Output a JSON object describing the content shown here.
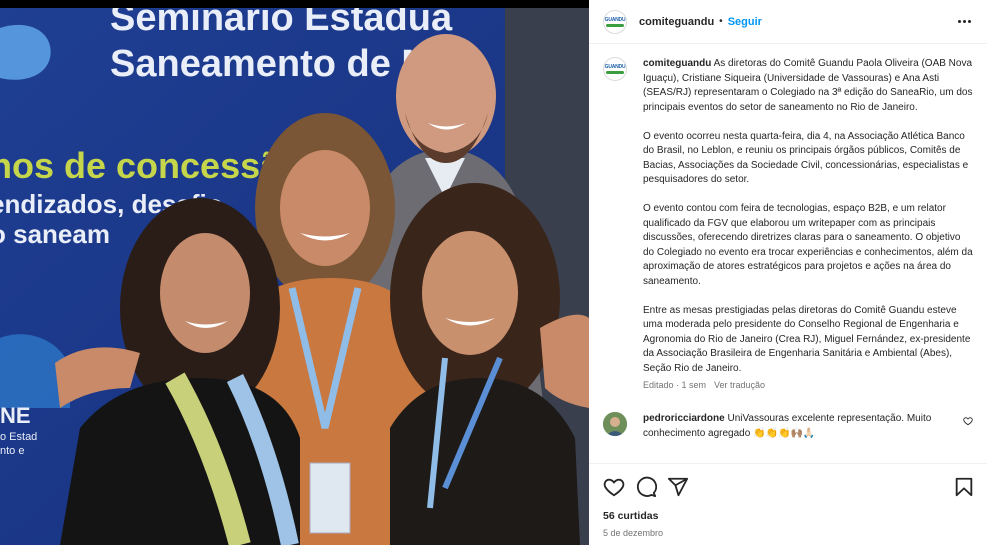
{
  "post": {
    "image_alt": "Foto de quatro pessoas sorrindo em frente a painel do Seminário Estadual de Saneamento",
    "banner_lines": [
      "Seminário Estadua",
      "Saneamento de Me",
      "nos de concessã",
      "endizados, desafio",
      "o saneam"
    ],
    "banner_side": [
      "NE",
      "o Estad",
      "nto e"
    ]
  },
  "header": {
    "username": "comiteguandu",
    "separator": "•",
    "follow_label": "Seguir",
    "avatar_text": "GUANDU"
  },
  "caption": {
    "username": "comiteguandu",
    "paragraphs": [
      "As diretoras do Comitê Guandu Paola Oliveira (OAB Nova Iguaçu), Cristiane Siqueira (Universidade de Vassouras) e Ana Asti (SEAS/RJ) representaram o Colegiado na 3ª edição do SaneaRio, um dos principais eventos do setor de saneamento no Rio de Janeiro.",
      "O evento ocorreu nesta quarta-feira, dia 4, na Associação Atlética Banco do Brasil, no Leblon, e reuniu os principais órgãos públicos, Comitês de Bacias, Associações da Sociedade Civil, concessionárias, especialistas e pesquisadores do setor.",
      "O evento contou com feira de tecnologias, espaço B2B, e um relator qualificado da FGV que elaborou um writepaper com as principais discussões, oferecendo diretrizes claras para o saneamento. O objetivo do Colegiado no evento era trocar experiências e conhecimentos, além da aproximação de atores estratégicos para projetos e ações na área do saneamento.",
      "Entre as mesas prestigiadas pelas diretoras do Comitê Guandu esteve uma moderada pelo presidente do Conselho Regional de Engenharia e Agronomia do Rio de Janeiro (Crea RJ), Miguel Fernández, ex-presidente da Associação Brasileira de Engenharia Sanitária e Ambiental (Abes), Seção Rio de Janeiro."
    ],
    "edited": "Editado · 1 sem",
    "translate_label": "Ver tradução"
  },
  "comment": {
    "username": "pedroricciardone",
    "text": "UniVassouras excelente representação. Muito conhecimento agregado",
    "emojis": "👏👏👏🙌🏽🙏🏻"
  },
  "footer": {
    "likes": "56 curtidas",
    "date": "5 de dezembro"
  },
  "icons": [
    "heart-icon",
    "comment-icon",
    "share-icon",
    "bookmark-icon",
    "more-icon"
  ]
}
